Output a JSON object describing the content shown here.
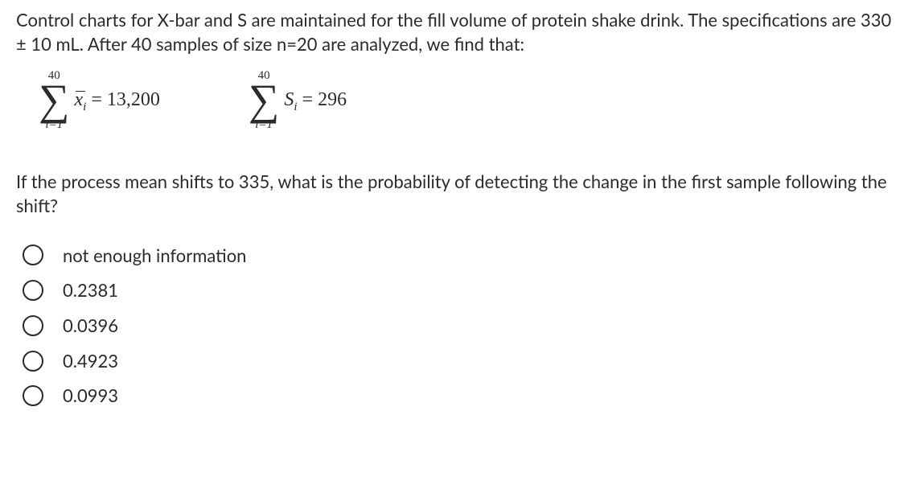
{
  "question": {
    "intro": "Control charts for X-bar and S are maintained for the fill volume of protein shake drink. The specifications are 330 ± 10 mL. After 40 samples of size n=20 are analyzed, we find that:",
    "eq1_top": "40",
    "eq1_bottom": "i=1",
    "eq1_rhs": " = 13,200",
    "eq2_top": "40",
    "eq2_bottom": "i=1",
    "eq2_rhs": " = 296",
    "sub": "If the process mean shifts to 335, what is the probability of detecting the change in the first sample following the shift?"
  },
  "options": [
    "not enough information",
    "0.2381",
    "0.0396",
    "0.4923",
    "0.0993"
  ]
}
